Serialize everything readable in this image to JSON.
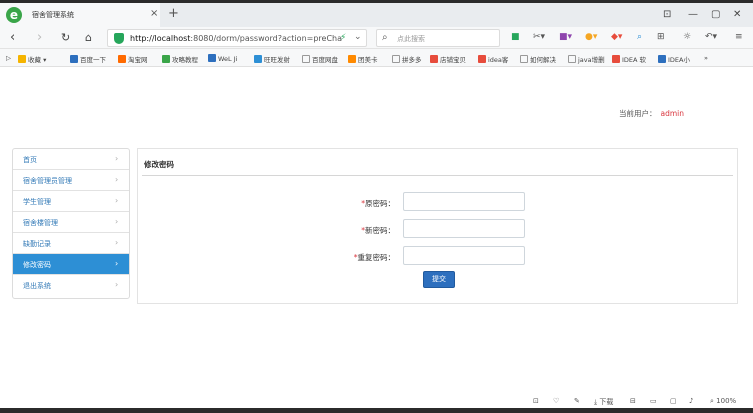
{
  "browser": {
    "tab_title": "宿舍管理系统",
    "tab_close": "×",
    "new_tab": "+",
    "url_host": "http://localhost",
    "url_rest": ":8080/dorm/password?action=preCha",
    "search_placeholder": "点此搜索",
    "bookmarks": [
      "收藏",
      "百度一下",
      "淘宝网",
      "攻略教程",
      "WeL Ji",
      "旺旺发射",
      "百度网盘",
      "团美卡",
      "拼多多",
      "店铺宝贝",
      "idea客",
      "如何解决",
      "java增删",
      "IDEA 软",
      "IDEA小"
    ],
    "bookmarks_more": "»",
    "zoom": "100%",
    "download_label": "下载"
  },
  "header": {
    "current_user_label": "当前用户：",
    "current_user": "admin"
  },
  "sidebar": {
    "items": [
      {
        "label": "首页"
      },
      {
        "label": "宿舍管理员管理"
      },
      {
        "label": "学生管理"
      },
      {
        "label": "宿舍楼管理"
      },
      {
        "label": "缺勤记录"
      },
      {
        "label": "修改密码"
      },
      {
        "label": "退出系统"
      }
    ]
  },
  "panel": {
    "title": "修改密码",
    "fields": [
      {
        "label": "原密码：",
        "value": ""
      },
      {
        "label": "新密码：",
        "value": ""
      },
      {
        "label": "重复密码：",
        "value": ""
      }
    ],
    "required_mark": "*",
    "submit_label": "提交"
  },
  "colors": {
    "accent": "#2d8fd5",
    "link": "#337ab7",
    "required": "#d9363e",
    "button": "#2d6fbe"
  }
}
